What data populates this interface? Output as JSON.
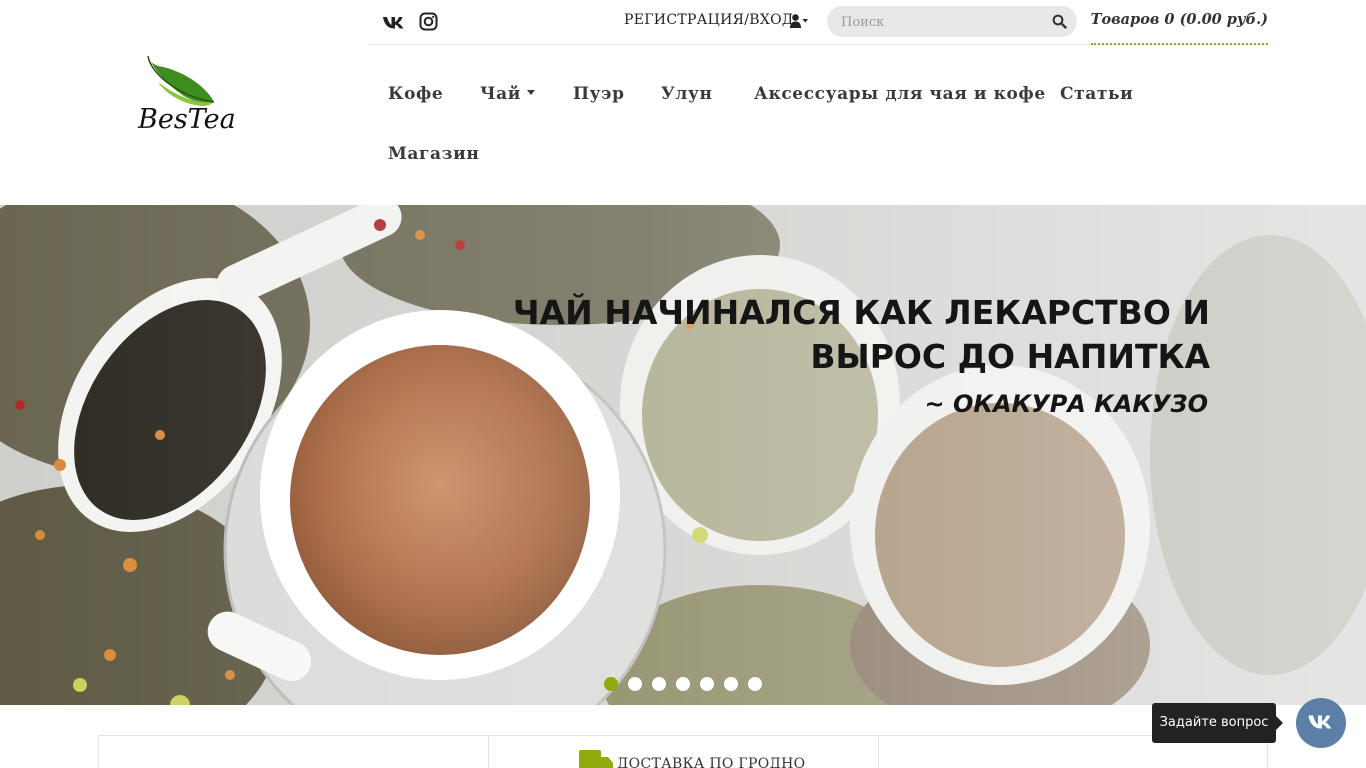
{
  "header": {
    "logo_text": "BesTea",
    "register_label": "РЕГИСТРАЦИЯ/ВХОД",
    "search": {
      "placeholder": "Поиск",
      "value": ""
    },
    "cart_label": "Товаров 0 (0.00 руб.)"
  },
  "social": [
    {
      "icon": "vk-icon"
    },
    {
      "icon": "instagram-icon"
    }
  ],
  "nav": {
    "items": [
      {
        "label": "Кофе"
      },
      {
        "label": "Чай",
        "has_dropdown": true
      },
      {
        "label": "Пуэр"
      },
      {
        "label": "Улун"
      },
      {
        "label": "Аксессуары для чая и кофе"
      },
      {
        "label": "Статьи"
      },
      {
        "label": "Магазин"
      }
    ]
  },
  "hero": {
    "quote_line1": "ЧАЙ НАЧИНАЛСЯ КАК ЛЕКАРСТВО И",
    "quote_line2": "ВЫРОС ДО НАПИТКА",
    "author": "~ ОКАКУРА КАКУЗО",
    "slides_count": 7,
    "active_slide": 1
  },
  "features": {
    "delivery_label": "ДОСТАВКА ПО ГРОДНО"
  },
  "widget": {
    "tooltip": "Задайте вопрос",
    "icon": "vk-icon"
  },
  "colors": {
    "accent": "#8eaa0c",
    "cart_underline": "#8bab1e",
    "vk_button": "#5b7fa6",
    "tooltip_bg": "#222222",
    "logo_leaf": "#3f8c1e"
  }
}
